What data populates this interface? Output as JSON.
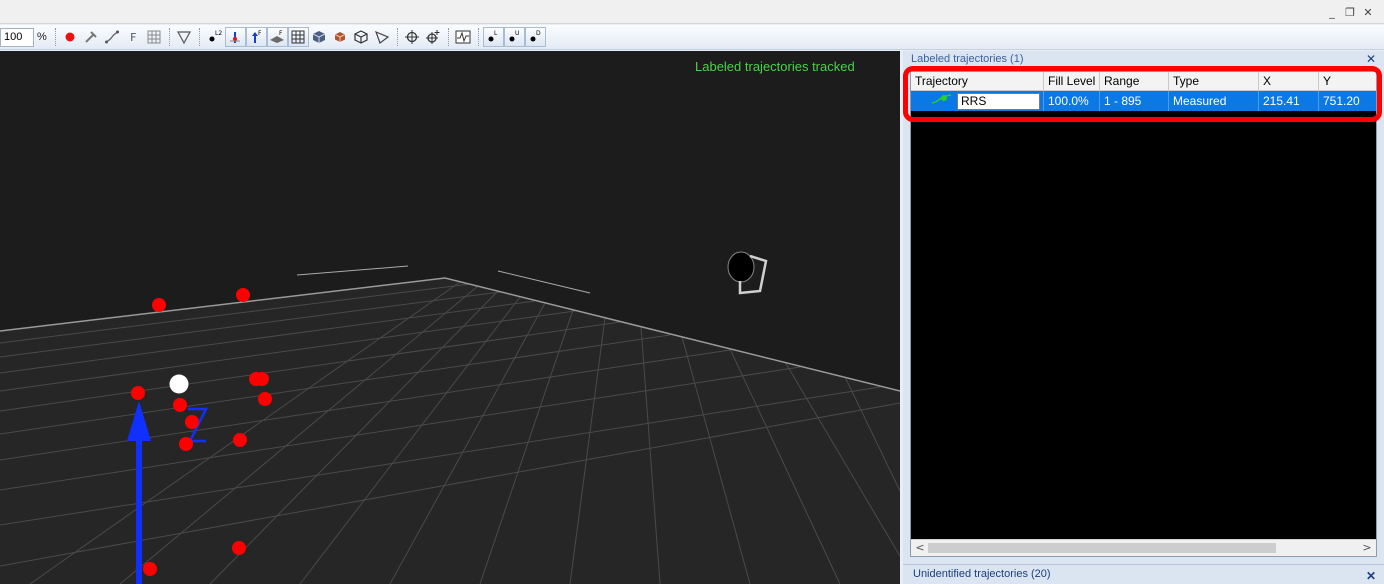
{
  "window": {
    "minimize": "_",
    "restore": "❐",
    "close": "✕"
  },
  "toolbar": {
    "zoom_value": "100",
    "zoom_unit": "%",
    "f_label": "F",
    "icons": [
      "record-icon",
      "hammer-icon",
      "trajectory-tool-icon",
      "force-icon",
      "grid-icon",
      "filter-icon",
      "marker-l2-icon",
      "axis-icon",
      "force-plate-icon",
      "floor-icon",
      "grid-toggle-icon",
      "cube-icon",
      "box-icon",
      "wire-cube-icon",
      "camera-cone-icon",
      "crosshair-icon",
      "crosshair-plus-icon",
      "waveform-icon",
      "label-l-icon",
      "label-u-icon",
      "label-d-icon"
    ]
  },
  "viewport": {
    "title": "Labeled trajectories tracked",
    "title_color": "#4cd04c"
  },
  "labeled_panel": {
    "header": "Labeled trajectories (1)",
    "columns": [
      "Trajectory",
      "Fill Level",
      "Range",
      "Type",
      "X",
      "Y"
    ],
    "row": {
      "trajectory": "RRS",
      "fill_level": "100.0%",
      "range": "1 - 895",
      "type": "Measured",
      "x": "215.41",
      "y": "751.20"
    },
    "scroll_left": "<",
    "scroll_right": ">"
  },
  "unidentified_panel": {
    "header": "Unidentified trajectories (20)"
  },
  "colors": {
    "marker": "#ff0000",
    "selected_row": "#0a79e6",
    "highlight": "#ff0000",
    "axis": "#1030ff"
  }
}
